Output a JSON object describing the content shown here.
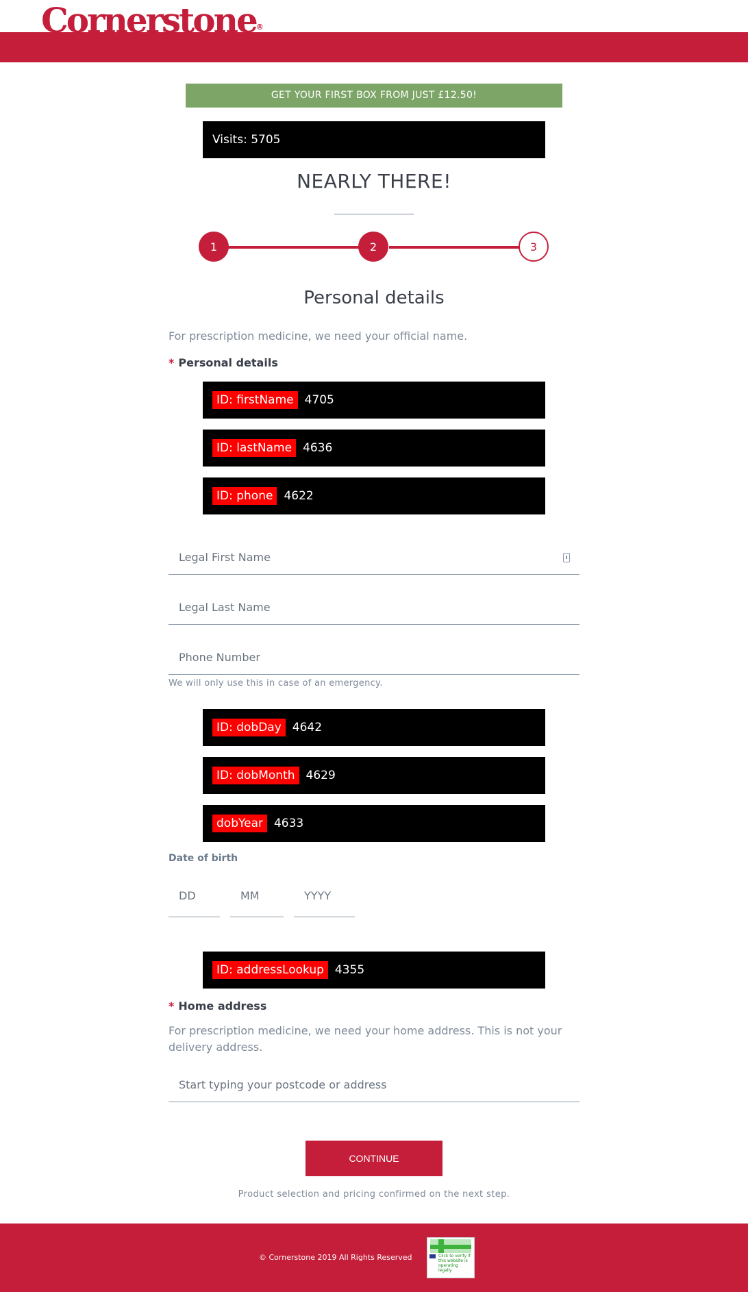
{
  "brand": {
    "logo_text": "Cornerstone",
    "registered": "®"
  },
  "promo": {
    "text": "GET YOUR FIRST BOX FROM JUST £12.50!"
  },
  "visits": {
    "text": "Visits: 5705"
  },
  "page_title": "NEARLY THERE!",
  "steps": [
    {
      "label": "1",
      "state": "complete"
    },
    {
      "label": "2",
      "state": "current"
    },
    {
      "label": "3",
      "state": "upcoming"
    }
  ],
  "personal": {
    "heading": "Personal details",
    "intro": "For prescription medicine, we need your official name.",
    "required_star": "*",
    "label": "Personal details",
    "debug_bars": [
      {
        "tag": "ID: firstName",
        "value": "4705"
      },
      {
        "tag": "ID: lastName",
        "value": "4636"
      },
      {
        "tag": "ID: phone",
        "value": "4622"
      }
    ],
    "first_name_placeholder": "Legal First Name",
    "last_name_placeholder": "Legal Last Name",
    "phone_placeholder": "Phone Number",
    "phone_note": "We will only use this in case of an emergency."
  },
  "dob": {
    "debug_bars": [
      {
        "tag": "ID: dobDay",
        "value": "4642"
      },
      {
        "tag": "ID: dobMonth",
        "value": "4629"
      },
      {
        "tag": "dobYear",
        "value": "4633"
      }
    ],
    "label": "Date of birth",
    "day_placeholder": "DD",
    "month_placeholder": "MM",
    "year_placeholder": "YYYY"
  },
  "address": {
    "debug_bar": {
      "tag": "ID: addressLookup",
      "value": "4355"
    },
    "required_star": "*",
    "label": "Home address",
    "intro": "For prescription medicine, we need your home address. This is not your delivery address.",
    "placeholder": "Start typing your postcode or address"
  },
  "cta": {
    "label": "CONTINUE"
  },
  "cta_note": "Product selection and pricing confirmed on the next step.",
  "footer": {
    "copyright": "© Cornerstone 2019 All Rights Reserved",
    "badge_text": "Click to verify if this website is operating legally"
  },
  "colors": {
    "brand_red": "#c41e3a",
    "promo_green": "#7da567",
    "debug_red": "#ff0000"
  }
}
